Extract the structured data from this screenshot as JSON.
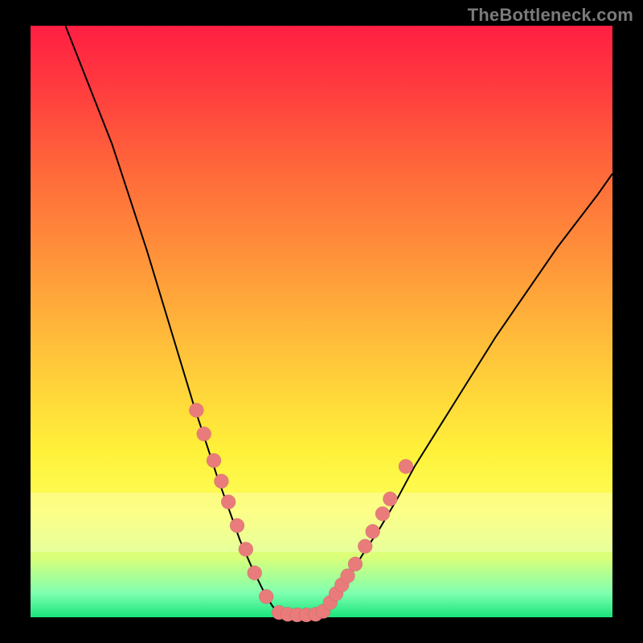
{
  "watermark": "TheBottleneck.com",
  "colors": {
    "dot": "#e97b7b",
    "curve": "#000000",
    "frame": "#000000"
  },
  "chart_data": {
    "type": "line",
    "title": "",
    "xlabel": "",
    "ylabel": "",
    "xlim": [
      0,
      100
    ],
    "ylim": [
      0,
      100
    ],
    "grid": false,
    "legend": null,
    "series": [
      {
        "name": "curve-left",
        "x": [
          6,
          8,
          10,
          12,
          14,
          16,
          18,
          20,
          22,
          24,
          26,
          28,
          30,
          32,
          34,
          36,
          38,
          40,
          41.5,
          42.67
        ],
        "y": [
          100,
          95,
          90,
          85,
          80,
          74,
          68,
          62,
          55.5,
          49,
          42.5,
          36,
          30,
          24,
          18.5,
          13,
          8.5,
          4.5,
          2,
          0.5
        ]
      },
      {
        "name": "curve-flat",
        "x": [
          42.67,
          44,
          45.5,
          47,
          48.5,
          50
        ],
        "y": [
          0.5,
          0.3,
          0.2,
          0.2,
          0.3,
          0.5
        ]
      },
      {
        "name": "curve-right",
        "x": [
          50,
          52,
          54.5,
          57,
          60,
          63,
          66,
          69.5,
          73,
          76.5,
          80,
          83.5,
          87,
          90.5,
          94,
          97.5,
          100
        ],
        "y": [
          0.5,
          3,
          6.5,
          10.5,
          15,
          20,
          25.5,
          31,
          36.5,
          42,
          47.5,
          52.5,
          57.5,
          62.5,
          67,
          71.5,
          75
        ]
      }
    ],
    "highlight_points": [
      {
        "segment": "left",
        "x": 28.5,
        "y": 35
      },
      {
        "segment": "left",
        "x": 29.8,
        "y": 31
      },
      {
        "segment": "left",
        "x": 31.5,
        "y": 26.5
      },
      {
        "segment": "left",
        "x": 32.8,
        "y": 23
      },
      {
        "segment": "left",
        "x": 34.0,
        "y": 19.5
      },
      {
        "segment": "left",
        "x": 35.5,
        "y": 15.5
      },
      {
        "segment": "left",
        "x": 37.0,
        "y": 11.5
      },
      {
        "segment": "left",
        "x": 38.5,
        "y": 7.5
      },
      {
        "segment": "left",
        "x": 40.5,
        "y": 3.5
      },
      {
        "segment": "flat",
        "x": 42.7,
        "y": 0.8
      },
      {
        "segment": "flat",
        "x": 44.2,
        "y": 0.5
      },
      {
        "segment": "flat",
        "x": 45.8,
        "y": 0.4
      },
      {
        "segment": "flat",
        "x": 47.4,
        "y": 0.4
      },
      {
        "segment": "flat",
        "x": 49.0,
        "y": 0.5
      },
      {
        "segment": "right",
        "x": 50.3,
        "y": 1.0
      },
      {
        "segment": "right",
        "x": 51.5,
        "y": 2.5
      },
      {
        "segment": "right",
        "x": 52.5,
        "y": 4.0
      },
      {
        "segment": "right",
        "x": 53.5,
        "y": 5.5
      },
      {
        "segment": "right",
        "x": 54.5,
        "y": 7.0
      },
      {
        "segment": "right",
        "x": 55.8,
        "y": 9.0
      },
      {
        "segment": "right",
        "x": 57.5,
        "y": 12.0
      },
      {
        "segment": "right",
        "x": 58.8,
        "y": 14.5
      },
      {
        "segment": "right",
        "x": 60.5,
        "y": 17.5
      },
      {
        "segment": "right",
        "x": 61.8,
        "y": 20.0
      },
      {
        "segment": "right",
        "x": 64.5,
        "y": 25.5
      }
    ],
    "pale_band": {
      "y0": 79,
      "y1": 89
    }
  }
}
